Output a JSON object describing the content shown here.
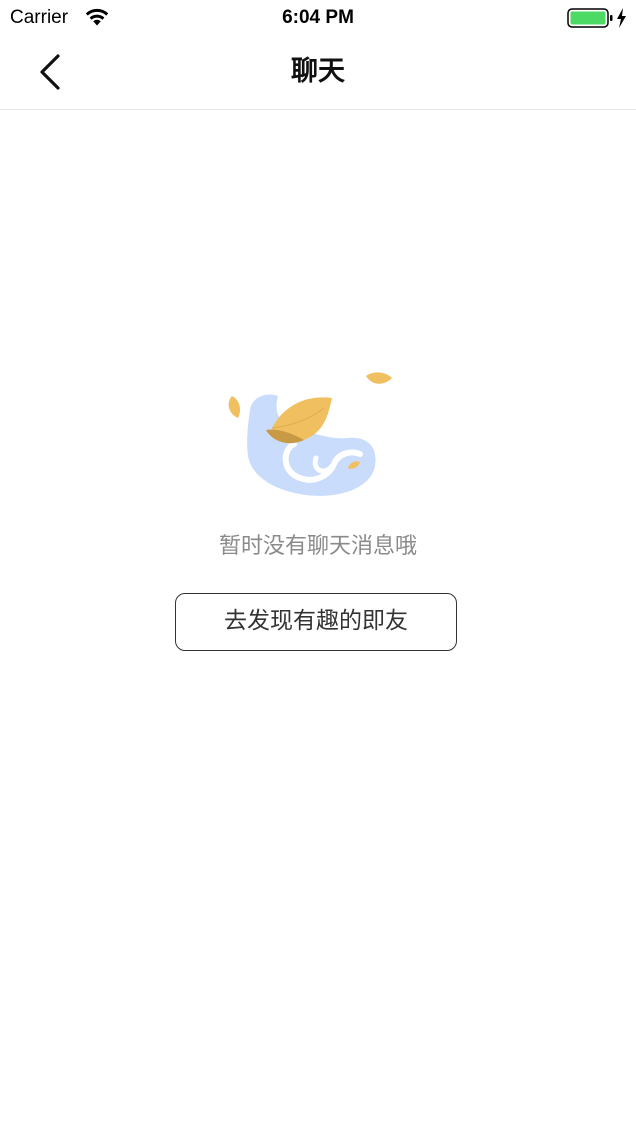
{
  "status_bar": {
    "carrier": "Carrier",
    "time": "6:04 PM",
    "wifi_icon": "wifi-icon",
    "battery_icon": "battery-charging-icon",
    "battery_color": "#4cd964"
  },
  "nav": {
    "back_icon": "chevron-left-icon",
    "title": "聊天"
  },
  "empty_state": {
    "illustration_icon": "empty-chat-illustration",
    "message": "暂时没有聊天消息哦",
    "button_label": "去发现有趣的即友",
    "accent_colors": {
      "leaf": "#f0c060",
      "leaf_dark": "#c99a45",
      "bubble": "#c9dcfb"
    }
  }
}
